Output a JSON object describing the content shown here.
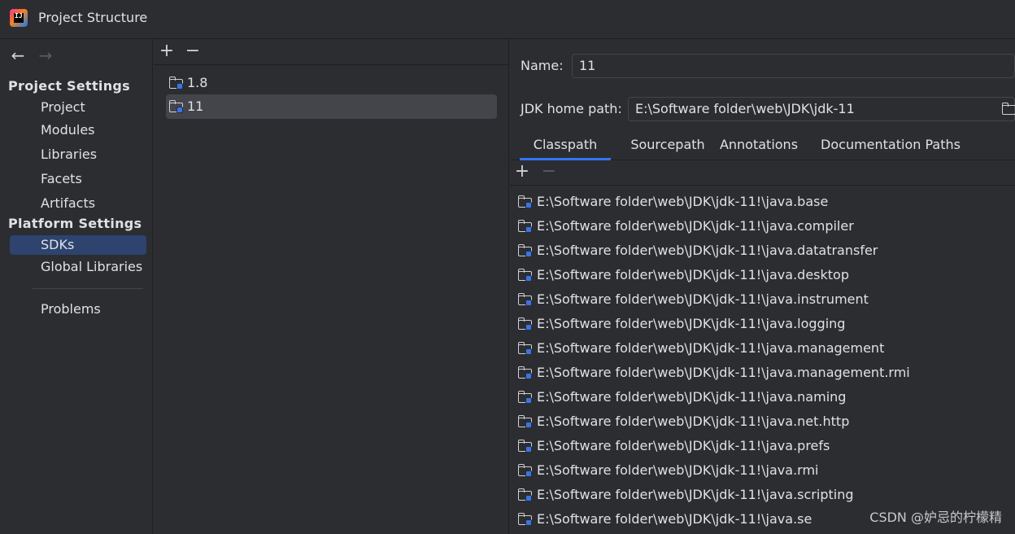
{
  "window": {
    "title": "Project Structure",
    "logo_text": "IJ"
  },
  "nav": {
    "back_glyph": "←",
    "forward_glyph": "→",
    "project_settings_title": "Project Settings",
    "project_settings_items": [
      "Project",
      "Modules",
      "Libraries",
      "Facets",
      "Artifacts"
    ],
    "platform_settings_title": "Platform Settings",
    "platform_settings_items": [
      "SDKs",
      "Global Libraries"
    ],
    "selected": "SDKs",
    "problems": "Problems"
  },
  "sdk_list": {
    "add_glyph": "+",
    "remove_glyph": "−",
    "items": [
      "1.8",
      "11"
    ],
    "selected": "11"
  },
  "details": {
    "name_label": "Name:",
    "name_value": "11",
    "jdk_home_label": "JDK home path:",
    "jdk_home_value": "E:\\Software folder\\web\\JDK\\jdk-11",
    "tabs": [
      "Classpath",
      "Sourcepath",
      "Annotations",
      "Documentation Paths"
    ],
    "active_tab": "Classpath",
    "add_glyph": "+",
    "remove_glyph": "−",
    "classpath": [
      "E:\\Software folder\\web\\JDK\\jdk-11!\\java.base",
      "E:\\Software folder\\web\\JDK\\jdk-11!\\java.compiler",
      "E:\\Software folder\\web\\JDK\\jdk-11!\\java.datatransfer",
      "E:\\Software folder\\web\\JDK\\jdk-11!\\java.desktop",
      "E:\\Software folder\\web\\JDK\\jdk-11!\\java.instrument",
      "E:\\Software folder\\web\\JDK\\jdk-11!\\java.logging",
      "E:\\Software folder\\web\\JDK\\jdk-11!\\java.management",
      "E:\\Software folder\\web\\JDK\\jdk-11!\\java.management.rmi",
      "E:\\Software folder\\web\\JDK\\jdk-11!\\java.naming",
      "E:\\Software folder\\web\\JDK\\jdk-11!\\java.net.http",
      "E:\\Software folder\\web\\JDK\\jdk-11!\\java.prefs",
      "E:\\Software folder\\web\\JDK\\jdk-11!\\java.rmi",
      "E:\\Software folder\\web\\JDK\\jdk-11!\\java.scripting",
      "E:\\Software folder\\web\\JDK\\jdk-11!\\java.se"
    ]
  },
  "watermark": "CSDN @妒忌的柠檬精",
  "colors": {
    "background": "#2b2d30",
    "selection_nav": "#2e436e",
    "selection_list": "#43454a",
    "accent": "#3574f0",
    "text": "#dfe1e5"
  },
  "icons": {
    "folder": "folder-with-sdk-badge-icon",
    "browse": "folder-browse-icon"
  }
}
